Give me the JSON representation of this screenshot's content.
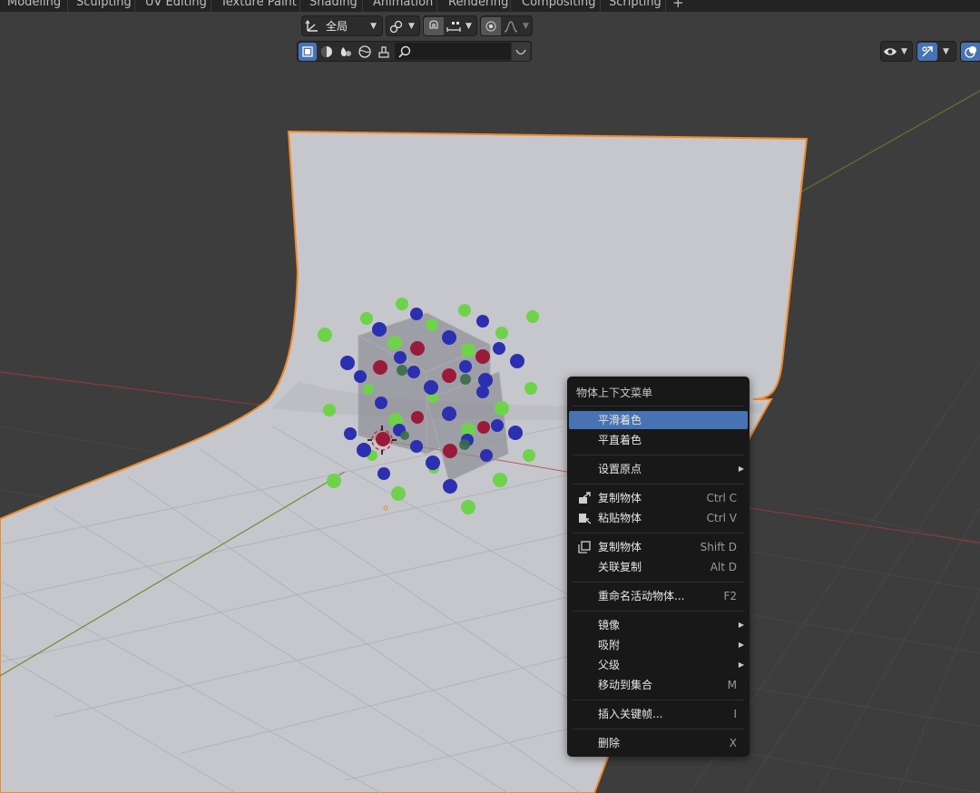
{
  "workspace_tabs": [
    "Modeling",
    "Sculpting",
    "UV Editing",
    "Texture Paint",
    "Shading",
    "Animation",
    "Rendering",
    "Compositing",
    "Scripting"
  ],
  "add_tab_label": "+",
  "toolbar": {
    "transform_orientation": "全局",
    "search_value": "",
    "active_color": "#4772b3"
  },
  "context_menu": {
    "title": "物体上下文菜单",
    "items": [
      {
        "label": "平滑着色",
        "shortcut": "",
        "submenu": false,
        "icon": "",
        "highlighted": true
      },
      {
        "label": "平直着色",
        "shortcut": "",
        "submenu": false,
        "icon": "",
        "highlighted": false
      },
      {
        "label": "设置原点",
        "shortcut": "",
        "submenu": true,
        "icon": "",
        "highlighted": false
      },
      {
        "label": "复制物体",
        "shortcut": "Ctrl C",
        "submenu": false,
        "icon": "copy-to-buffer-icon",
        "highlighted": false
      },
      {
        "label": "粘贴物体",
        "shortcut": "Ctrl V",
        "submenu": false,
        "icon": "paste-from-buffer-icon",
        "highlighted": false
      },
      {
        "label": "复制物体",
        "shortcut": "Shift D",
        "submenu": false,
        "icon": "duplicate-icon",
        "highlighted": false
      },
      {
        "label": "关联复制",
        "shortcut": "Alt D",
        "submenu": false,
        "icon": "",
        "highlighted": false
      },
      {
        "label": "重命名活动物体...",
        "shortcut": "F2",
        "submenu": false,
        "icon": "",
        "highlighted": false
      },
      {
        "label": "镜像",
        "shortcut": "",
        "submenu": true,
        "icon": "",
        "highlighted": false
      },
      {
        "label": "吸附",
        "shortcut": "",
        "submenu": true,
        "icon": "",
        "highlighted": false
      },
      {
        "label": "父级",
        "shortcut": "",
        "submenu": true,
        "icon": "",
        "highlighted": false
      },
      {
        "label": "移动到集合",
        "shortcut": "M",
        "submenu": false,
        "icon": "",
        "highlighted": false
      },
      {
        "label": "插入关键帧...",
        "shortcut": "I",
        "submenu": false,
        "icon": "",
        "highlighted": false
      },
      {
        "label": "删除",
        "shortcut": "X",
        "submenu": false,
        "icon": "",
        "highlighted": false
      }
    ]
  },
  "colors": {
    "viewport_bg": "#3d3d3d",
    "grid_line": "#474747",
    "x_axis": "#8a3a3a",
    "y_axis": "#5a7a2e",
    "backdrop": "#c6c7cc",
    "selection_outline": "#ef8a2a",
    "atom_green": "#6ed24a",
    "atom_blue": "#2b2fb0",
    "atom_red": "#9a1a3a",
    "menu_highlight": "#4772b3"
  }
}
